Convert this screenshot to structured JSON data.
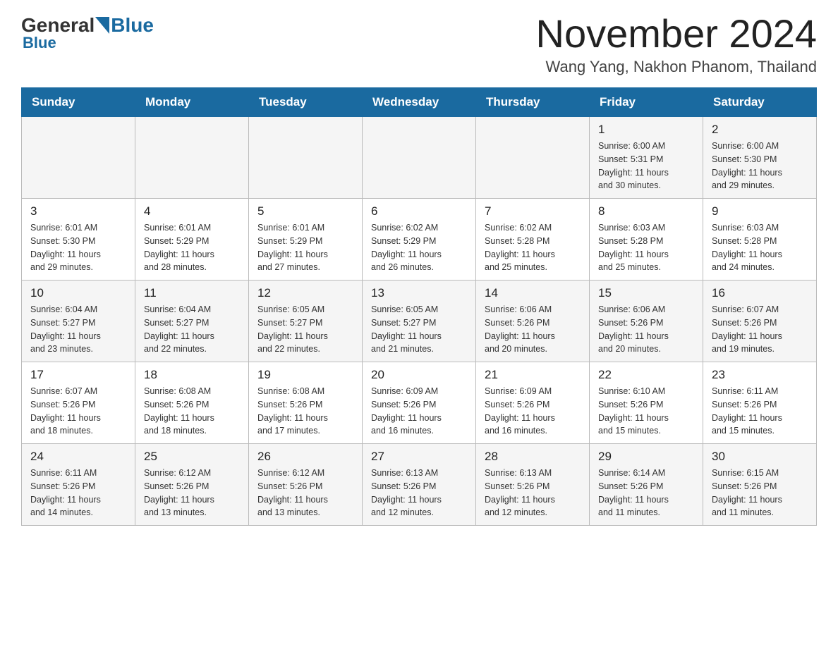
{
  "header": {
    "logo_general": "General",
    "logo_blue": "Blue",
    "month_title": "November 2024",
    "location": "Wang Yang, Nakhon Phanom, Thailand"
  },
  "weekdays": [
    "Sunday",
    "Monday",
    "Tuesday",
    "Wednesday",
    "Thursday",
    "Friday",
    "Saturday"
  ],
  "weeks": [
    {
      "days": [
        {
          "number": "",
          "info": ""
        },
        {
          "number": "",
          "info": ""
        },
        {
          "number": "",
          "info": ""
        },
        {
          "number": "",
          "info": ""
        },
        {
          "number": "",
          "info": ""
        },
        {
          "number": "1",
          "info": "Sunrise: 6:00 AM\nSunset: 5:31 PM\nDaylight: 11 hours\nand 30 minutes."
        },
        {
          "number": "2",
          "info": "Sunrise: 6:00 AM\nSunset: 5:30 PM\nDaylight: 11 hours\nand 29 minutes."
        }
      ]
    },
    {
      "days": [
        {
          "number": "3",
          "info": "Sunrise: 6:01 AM\nSunset: 5:30 PM\nDaylight: 11 hours\nand 29 minutes."
        },
        {
          "number": "4",
          "info": "Sunrise: 6:01 AM\nSunset: 5:29 PM\nDaylight: 11 hours\nand 28 minutes."
        },
        {
          "number": "5",
          "info": "Sunrise: 6:01 AM\nSunset: 5:29 PM\nDaylight: 11 hours\nand 27 minutes."
        },
        {
          "number": "6",
          "info": "Sunrise: 6:02 AM\nSunset: 5:29 PM\nDaylight: 11 hours\nand 26 minutes."
        },
        {
          "number": "7",
          "info": "Sunrise: 6:02 AM\nSunset: 5:28 PM\nDaylight: 11 hours\nand 25 minutes."
        },
        {
          "number": "8",
          "info": "Sunrise: 6:03 AM\nSunset: 5:28 PM\nDaylight: 11 hours\nand 25 minutes."
        },
        {
          "number": "9",
          "info": "Sunrise: 6:03 AM\nSunset: 5:28 PM\nDaylight: 11 hours\nand 24 minutes."
        }
      ]
    },
    {
      "days": [
        {
          "number": "10",
          "info": "Sunrise: 6:04 AM\nSunset: 5:27 PM\nDaylight: 11 hours\nand 23 minutes."
        },
        {
          "number": "11",
          "info": "Sunrise: 6:04 AM\nSunset: 5:27 PM\nDaylight: 11 hours\nand 22 minutes."
        },
        {
          "number": "12",
          "info": "Sunrise: 6:05 AM\nSunset: 5:27 PM\nDaylight: 11 hours\nand 22 minutes."
        },
        {
          "number": "13",
          "info": "Sunrise: 6:05 AM\nSunset: 5:27 PM\nDaylight: 11 hours\nand 21 minutes."
        },
        {
          "number": "14",
          "info": "Sunrise: 6:06 AM\nSunset: 5:26 PM\nDaylight: 11 hours\nand 20 minutes."
        },
        {
          "number": "15",
          "info": "Sunrise: 6:06 AM\nSunset: 5:26 PM\nDaylight: 11 hours\nand 20 minutes."
        },
        {
          "number": "16",
          "info": "Sunrise: 6:07 AM\nSunset: 5:26 PM\nDaylight: 11 hours\nand 19 minutes."
        }
      ]
    },
    {
      "days": [
        {
          "number": "17",
          "info": "Sunrise: 6:07 AM\nSunset: 5:26 PM\nDaylight: 11 hours\nand 18 minutes."
        },
        {
          "number": "18",
          "info": "Sunrise: 6:08 AM\nSunset: 5:26 PM\nDaylight: 11 hours\nand 18 minutes."
        },
        {
          "number": "19",
          "info": "Sunrise: 6:08 AM\nSunset: 5:26 PM\nDaylight: 11 hours\nand 17 minutes."
        },
        {
          "number": "20",
          "info": "Sunrise: 6:09 AM\nSunset: 5:26 PM\nDaylight: 11 hours\nand 16 minutes."
        },
        {
          "number": "21",
          "info": "Sunrise: 6:09 AM\nSunset: 5:26 PM\nDaylight: 11 hours\nand 16 minutes."
        },
        {
          "number": "22",
          "info": "Sunrise: 6:10 AM\nSunset: 5:26 PM\nDaylight: 11 hours\nand 15 minutes."
        },
        {
          "number": "23",
          "info": "Sunrise: 6:11 AM\nSunset: 5:26 PM\nDaylight: 11 hours\nand 15 minutes."
        }
      ]
    },
    {
      "days": [
        {
          "number": "24",
          "info": "Sunrise: 6:11 AM\nSunset: 5:26 PM\nDaylight: 11 hours\nand 14 minutes."
        },
        {
          "number": "25",
          "info": "Sunrise: 6:12 AM\nSunset: 5:26 PM\nDaylight: 11 hours\nand 13 minutes."
        },
        {
          "number": "26",
          "info": "Sunrise: 6:12 AM\nSunset: 5:26 PM\nDaylight: 11 hours\nand 13 minutes."
        },
        {
          "number": "27",
          "info": "Sunrise: 6:13 AM\nSunset: 5:26 PM\nDaylight: 11 hours\nand 12 minutes."
        },
        {
          "number": "28",
          "info": "Sunrise: 6:13 AM\nSunset: 5:26 PM\nDaylight: 11 hours\nand 12 minutes."
        },
        {
          "number": "29",
          "info": "Sunrise: 6:14 AM\nSunset: 5:26 PM\nDaylight: 11 hours\nand 11 minutes."
        },
        {
          "number": "30",
          "info": "Sunrise: 6:15 AM\nSunset: 5:26 PM\nDaylight: 11 hours\nand 11 minutes."
        }
      ]
    }
  ]
}
